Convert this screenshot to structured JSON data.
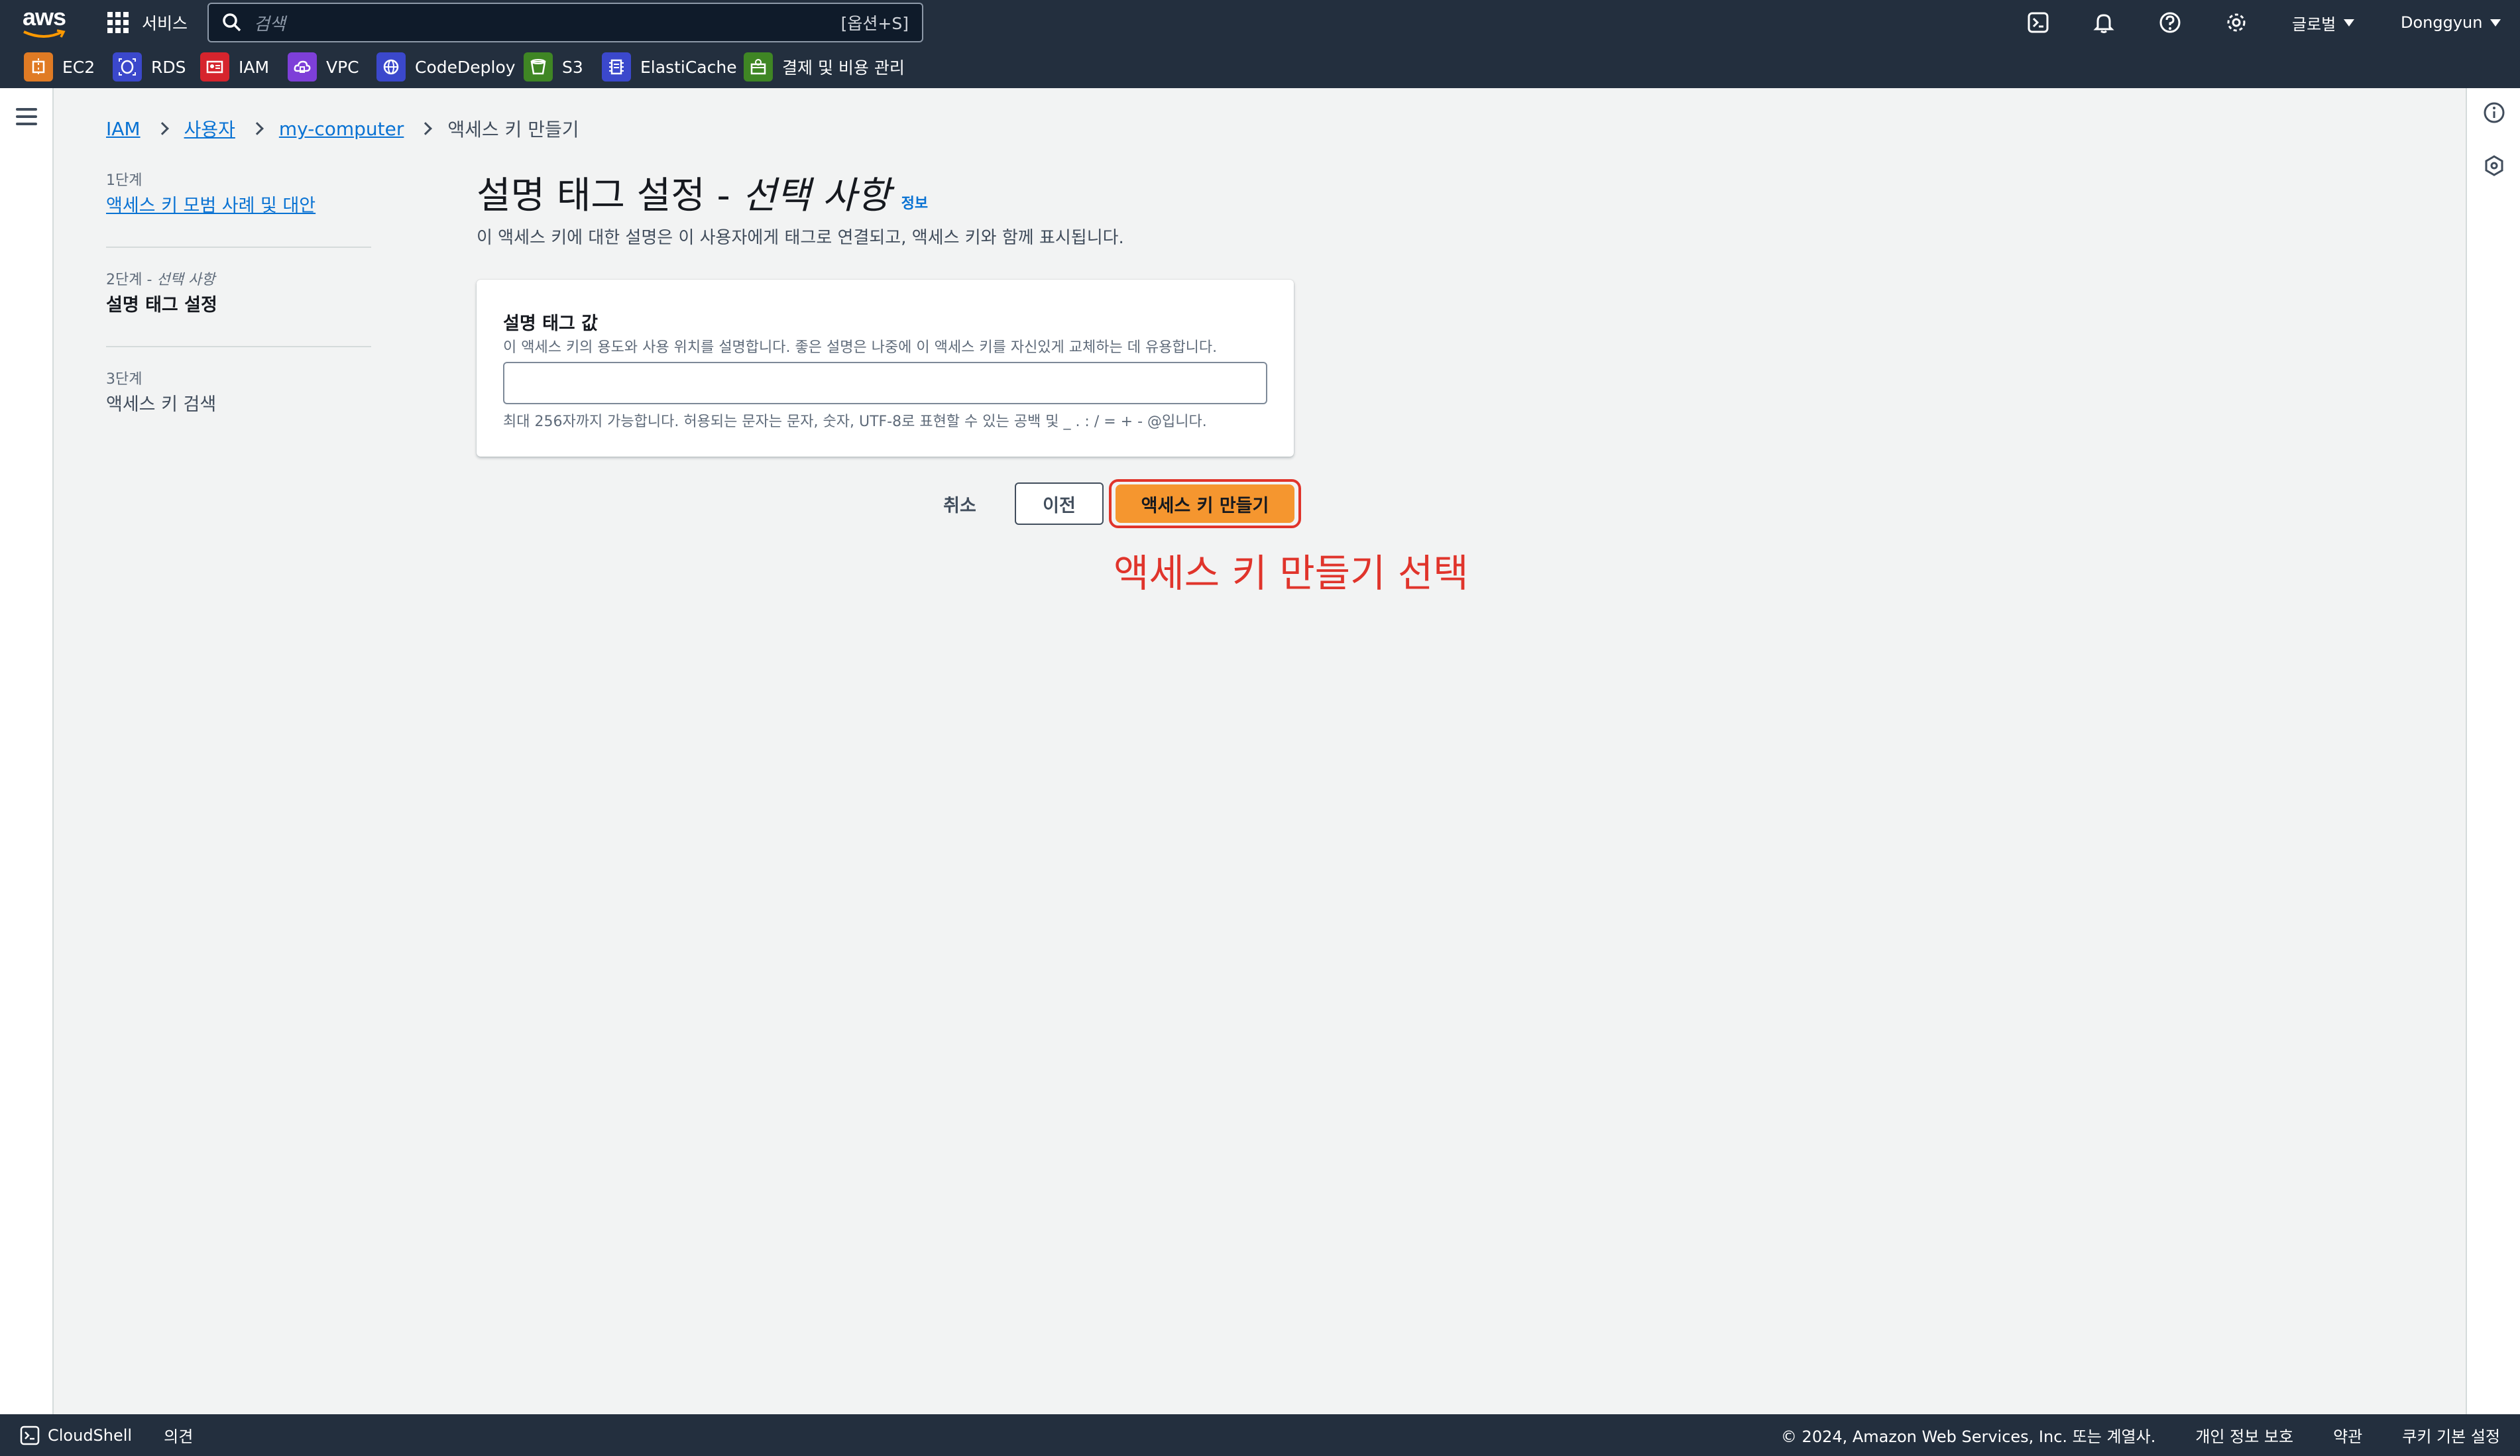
{
  "nav": {
    "logo": "aws",
    "services_label": "서비스",
    "search_placeholder": "검색",
    "search_shortcut": "[옵션+S]",
    "region": "글로벌",
    "user": "Donggyun",
    "favorites": [
      {
        "label": "EC2",
        "icon": "ec2-icon",
        "color": "#e07b24"
      },
      {
        "label": "RDS",
        "icon": "rds-icon",
        "color": "#3b48cc"
      },
      {
        "label": "IAM",
        "icon": "iam-icon",
        "color": "#d6242d"
      },
      {
        "label": "VPC",
        "icon": "vpc-icon",
        "color": "#7e3fd8"
      },
      {
        "label": "CodeDeploy",
        "icon": "codedeploy-icon",
        "color": "#3b48cc"
      },
      {
        "label": "S3",
        "icon": "s3-icon",
        "color": "#3f8624"
      },
      {
        "label": "ElastiCache",
        "icon": "elasticache-icon",
        "color": "#3b48cc"
      },
      {
        "label": "결제 및 비용 관리",
        "icon": "billing-icon",
        "color": "#3f8624"
      }
    ]
  },
  "breadcrumb": {
    "items": [
      "IAM",
      "사용자",
      "my-computer"
    ],
    "current": "액세스 키 만들기"
  },
  "steps": [
    {
      "num": "1단계",
      "label": "액세스 키 모범 사례 및 대안"
    },
    {
      "num": "2단계",
      "optional": "선택 사항",
      "label": "설명 태그 설정"
    },
    {
      "num": "3단계",
      "label": "액세스 키 검색"
    }
  ],
  "page": {
    "title": "설명 태그 설정 -",
    "title_optional": "선택 사항",
    "info": "정보",
    "description": "이 액세스 키에 대한 설명은 이 사용자에게 태그로 연결되고, 액세스 키와 함께 표시됩니다."
  },
  "form": {
    "field_label": "설명 태그 값",
    "field_description": "이 액세스 키의 용도와 사용 위치를 설명합니다. 좋은 설명은 나중에 이 액세스 키를 자신있게 교체하는 데 유용합니다.",
    "value": "",
    "constraint": "최대 256자까지 가능합니다. 허용되는 문자는 문자, 숫자, UTF-8로 표현할 수 있는 공백 및 _ . : / = + - @입니다."
  },
  "actions": {
    "cancel": "취소",
    "previous": "이전",
    "create": "액세스 키 만들기"
  },
  "annotation": "액세스 키 만들기 선택",
  "footer": {
    "cloudshell": "CloudShell",
    "feedback": "의견",
    "copyright": "© 2024, Amazon Web Services, Inc. 또는 계열사.",
    "privacy": "개인 정보 보호",
    "terms": "약관",
    "cookies": "쿠키 기본 설정"
  }
}
